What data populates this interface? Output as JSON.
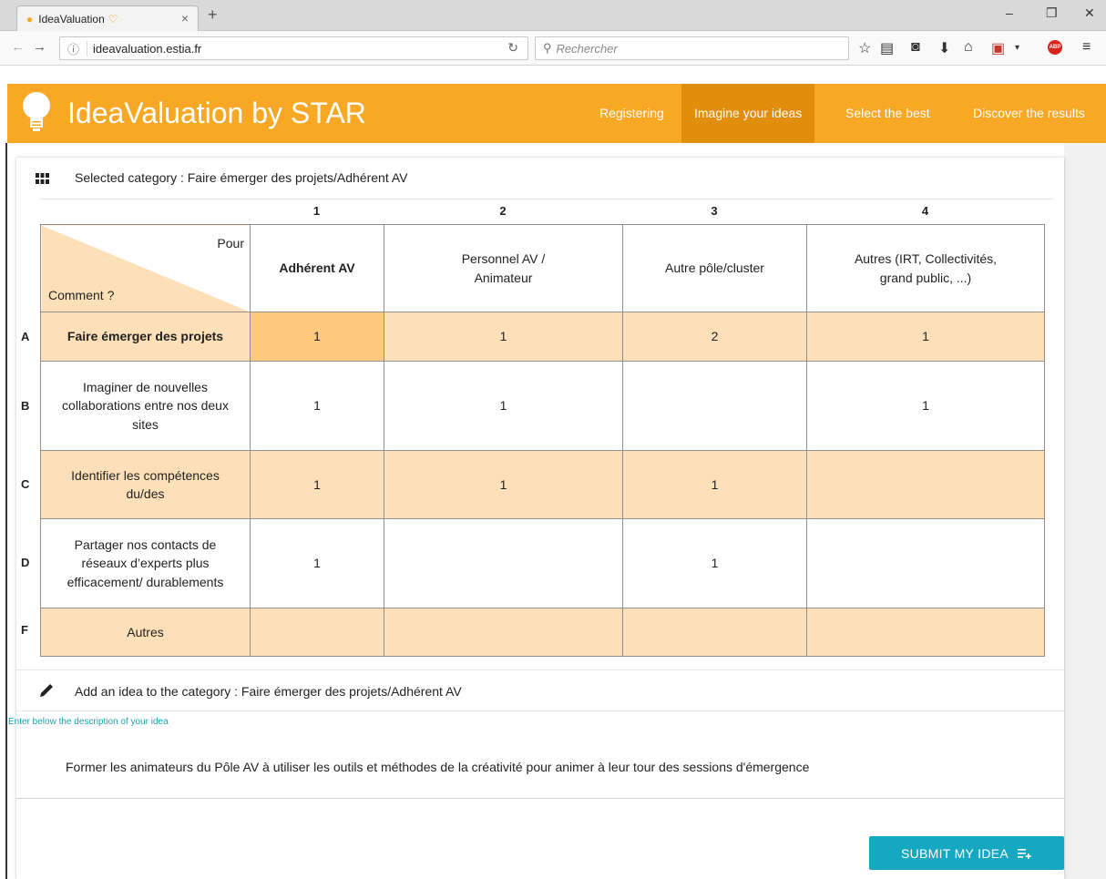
{
  "browser": {
    "tab_title": "IdeaValuation",
    "url_host": "ideavaluation.",
    "url_domain": "estia.fr",
    "search_placeholder": "Rechercher"
  },
  "app": {
    "title": "IdeaValuation by STAR",
    "brand_color": "#f9a825",
    "nav": [
      {
        "label": "Registering"
      },
      {
        "label": "Imagine your ideas",
        "active": true
      },
      {
        "label": "Select the best"
      },
      {
        "label": "Discover the results"
      }
    ]
  },
  "category": {
    "label": "Selected category : Faire émerger des projets/Adhérent AV"
  },
  "matrix": {
    "column_numbers": [
      "1",
      "2",
      "3",
      "4"
    ],
    "corner_top": "Pour",
    "corner_bottom": "Comment ?",
    "columns": [
      "Adhérent AV",
      "Personnel AV / Animateur",
      "Autre pôle/cluster",
      "Autres (IRT, Collectivités, grand public, ...)"
    ],
    "rows": [
      {
        "letter": "A",
        "label": "Faire émerger des projets",
        "cells": [
          "1",
          "1",
          "2",
          "1"
        ]
      },
      {
        "letter": "B",
        "label": "Imaginer de nouvelles collaborations entre nos deux sites",
        "cells": [
          "1",
          "1",
          "",
          "1"
        ]
      },
      {
        "letter": "C",
        "label": "Identifier les compétences du/des",
        "cells": [
          "1",
          "1",
          "1",
          ""
        ]
      },
      {
        "letter": "D",
        "label": "Partager nos contacts de réseaux d’experts plus efficacement/ durablements",
        "cells": [
          "1",
          "",
          "1",
          ""
        ]
      },
      {
        "letter": "F",
        "label": "Autres",
        "cells": [
          "",
          "",
          "",
          ""
        ]
      }
    ]
  },
  "idea_form": {
    "add_label": "Add an idea to the category : Faire émerger des projets/Adhérent AV",
    "field_label": "Enter below the description of your idea",
    "value": "Former les animateurs du Pôle AV à utiliser les outils et méthodes de la créativité pour animer à leur tour des sessions d'émergence",
    "submit_label": "SUBMIT MY IDEA"
  }
}
